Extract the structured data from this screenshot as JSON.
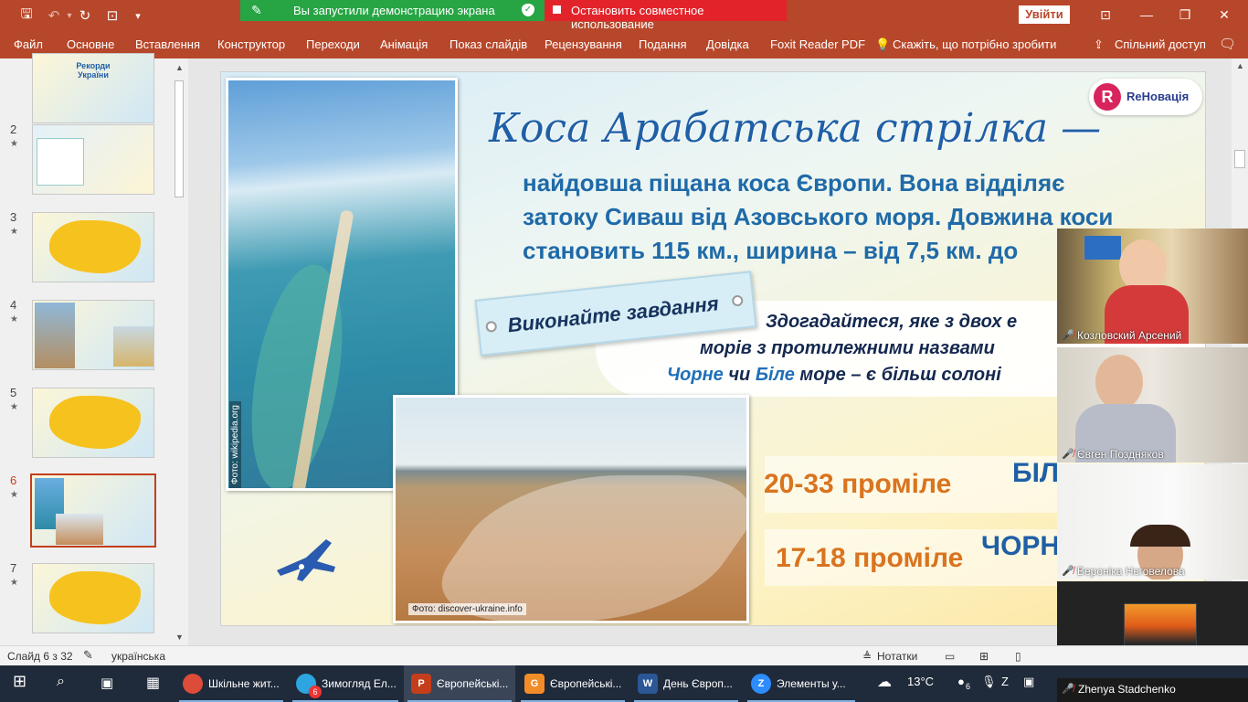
{
  "titlebar": {
    "share_status": "Вы запустили демонстрацию экрана",
    "stop_share": "Остановить совместное использование",
    "signin": "Увійти"
  },
  "ribbon": {
    "tabs": [
      "Файл",
      "Основне",
      "Вставлення",
      "Конструктор",
      "Переходи",
      "Анімація",
      "Показ слайдів",
      "Рецензування",
      "Подання",
      "Довідка",
      "Foxit Reader PDF"
    ],
    "tellme": "Скажіть, що потрібно зробити",
    "share": "Спільний доступ"
  },
  "thumbnails": {
    "items": [
      {
        "num": "",
        "star": "",
        "title": "Рекорди України"
      },
      {
        "num": "2",
        "star": "★"
      },
      {
        "num": "3",
        "star": "★"
      },
      {
        "num": "4",
        "star": "★"
      },
      {
        "num": "5",
        "star": "★"
      },
      {
        "num": "6",
        "star": "★"
      },
      {
        "num": "7",
        "star": "★"
      }
    ],
    "selected": 6
  },
  "slide": {
    "logo_text": "ReНовація",
    "logo_letter": "R",
    "heading_script": "Коса Арабатська стрілка —",
    "body_lines": [
      "найдовша піщана коса Європи. Вона відділяє",
      "затоку Сиваш від Азовського моря. Довжина коси",
      "становить 115 км., ширина – від 7,5 км. до"
    ],
    "task_label": "Виконайте завдання",
    "question_line1": "Здогадайтеся, яке з двох е",
    "question_line2": "морів з протилежними назвами",
    "question_line3_black": "Чорне",
    "question_line3_or": "чи",
    "question_line3_white": "Біле",
    "question_line3_rest": "море – є більш солоні",
    "answer1_value": "20-33 проміле",
    "answer1_sea": "БІЛ",
    "answer2_value": "17-18 проміле",
    "answer2_sea": "ЧОРН",
    "photo_top_credit": "Фото: wikipedia.org",
    "photo_bottom_credit": "Фото: discover-ukraine.info"
  },
  "participants": [
    {
      "name": "Козловский Арсений"
    },
    {
      "name": "Євген Поздняков"
    },
    {
      "name": "Вероніка Нєговелова"
    },
    {
      "name": "Zhenya Stadchenko"
    }
  ],
  "statusbar": {
    "slide_counter": "Слайд 6 з 32",
    "language": "українська",
    "notes": "Нотатки"
  },
  "taskbar": {
    "apps": [
      {
        "label": "Шкільне жит...",
        "icon": "chrome-icon"
      },
      {
        "label": "Зимогляд Ел...",
        "icon": "telegram-icon",
        "badge": "6"
      },
      {
        "label": "Європейські...",
        "icon": "powerpoint-icon"
      },
      {
        "label": "Європейські...",
        "icon": "foxit-icon"
      },
      {
        "label": "День Європ...",
        "icon": "word-icon"
      },
      {
        "label": "Элементы у...",
        "icon": "zoom-icon"
      }
    ],
    "temperature": "13°C",
    "tray_badge": "6"
  },
  "colors": {
    "accent": "#b7472a",
    "share_green": "#27a545",
    "stop_red": "#e3232a",
    "heading_blue": "#1f5fa6",
    "promile_orange": "#d9741f"
  }
}
